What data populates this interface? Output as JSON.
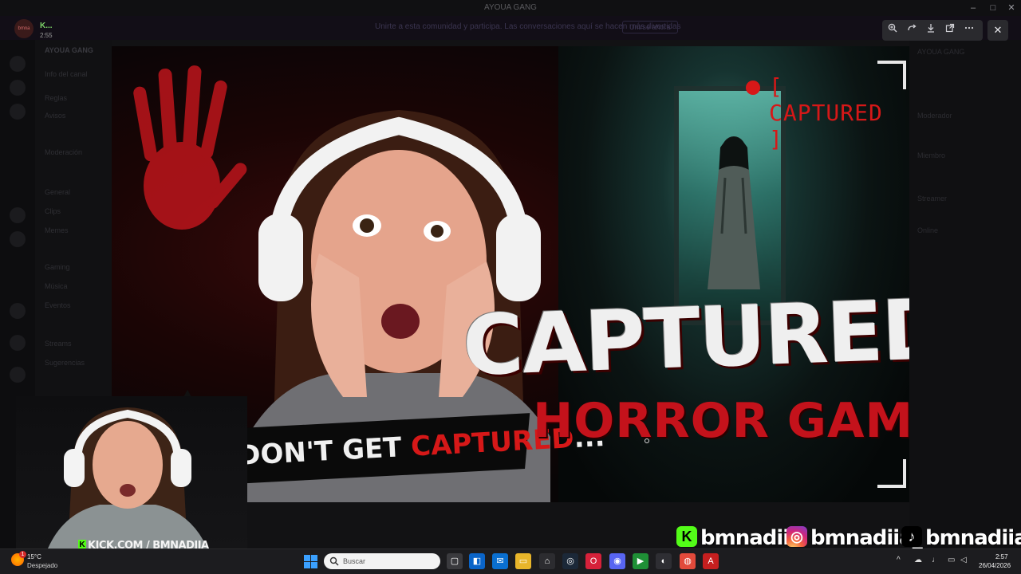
{
  "window": {
    "title": "AYOUA GANG",
    "controls": [
      "–",
      "□",
      "✕"
    ]
  },
  "viewer": {
    "author": "K...",
    "timestamp": "2:55",
    "avatar_text": "bmna",
    "notice_text": "Unirte a esta comunidad y participa. Las conversaciones aquí se hacen más divertidas",
    "notice_button": "Unirse ahora",
    "tools": [
      "zoom-in-icon",
      "rotate-icon",
      "download-icon",
      "open-external-icon",
      "more-icon"
    ],
    "close_label": "✕"
  },
  "background_app": {
    "server_name": "AYOUA GANG",
    "channels": [
      "Info del canal",
      "Reglas",
      "Avisos",
      "Moderación",
      "General",
      "Clips",
      "Memes",
      "Gaming",
      "Música",
      "Eventos",
      "Streams",
      "Sugerencias"
    ],
    "members": [
      "AYOUA GANG",
      "Moderador",
      "Miembro",
      "Streamer",
      "Online"
    ]
  },
  "thumbnail": {
    "rec_label": "[ CAPTURED ]",
    "title_main": "CAPTURED",
    "title_sub": "HORROR GAME",
    "tagline_prefix": "DON'T GET ",
    "tagline_red": "CAPTURED",
    "tagline_suffix": "...",
    "colors": {
      "accent_red": "#d61818",
      "teal_glow": "#6fd6c4"
    }
  },
  "webcam": {
    "url_badge": "K",
    "url_text": "KICK.COM / BMNADIIA"
  },
  "socials": [
    {
      "platform": "kick",
      "icon": "kick-icon",
      "glyph": "K",
      "handle": "bmnadiia"
    },
    {
      "platform": "instagram",
      "icon": "instagram-icon",
      "glyph": "◎",
      "handle": "bmnadiia_"
    },
    {
      "platform": "tiktok",
      "icon": "tiktok-icon",
      "glyph": "♪",
      "handle": "bmnadiia"
    }
  ],
  "taskbar": {
    "weather_temp": "15°C",
    "weather_desc": "Despejado",
    "weather_badge": "1",
    "search_placeholder": "Buscar",
    "apps": [
      {
        "name": "task-view",
        "glyph": "▢",
        "color": "#3a3a3e"
      },
      {
        "name": "store",
        "glyph": "◧",
        "color": "#0a64c8"
      },
      {
        "name": "outlook",
        "glyph": "✉",
        "color": "#0a6fd0"
      },
      {
        "name": "file-explorer",
        "glyph": "▭",
        "color": "#e8b52a"
      },
      {
        "name": "snipping",
        "glyph": "⌂",
        "color": "#2c2c30"
      },
      {
        "name": "steam",
        "glyph": "◎",
        "color": "#1b2838"
      },
      {
        "name": "opera",
        "glyph": "O",
        "color": "#d6213a"
      },
      {
        "name": "discord",
        "glyph": "◉",
        "color": "#5865f2"
      },
      {
        "name": "media-player",
        "glyph": "▶",
        "color": "#1f8f36"
      },
      {
        "name": "obs",
        "glyph": "◐",
        "color": "#2e2e33"
      },
      {
        "name": "chrome",
        "glyph": "◍",
        "color": "#e24a3b"
      },
      {
        "name": "acrobat",
        "glyph": "A",
        "color": "#c51f1f"
      }
    ],
    "clock_time": "2:57",
    "clock_date": "26/04/2026"
  }
}
